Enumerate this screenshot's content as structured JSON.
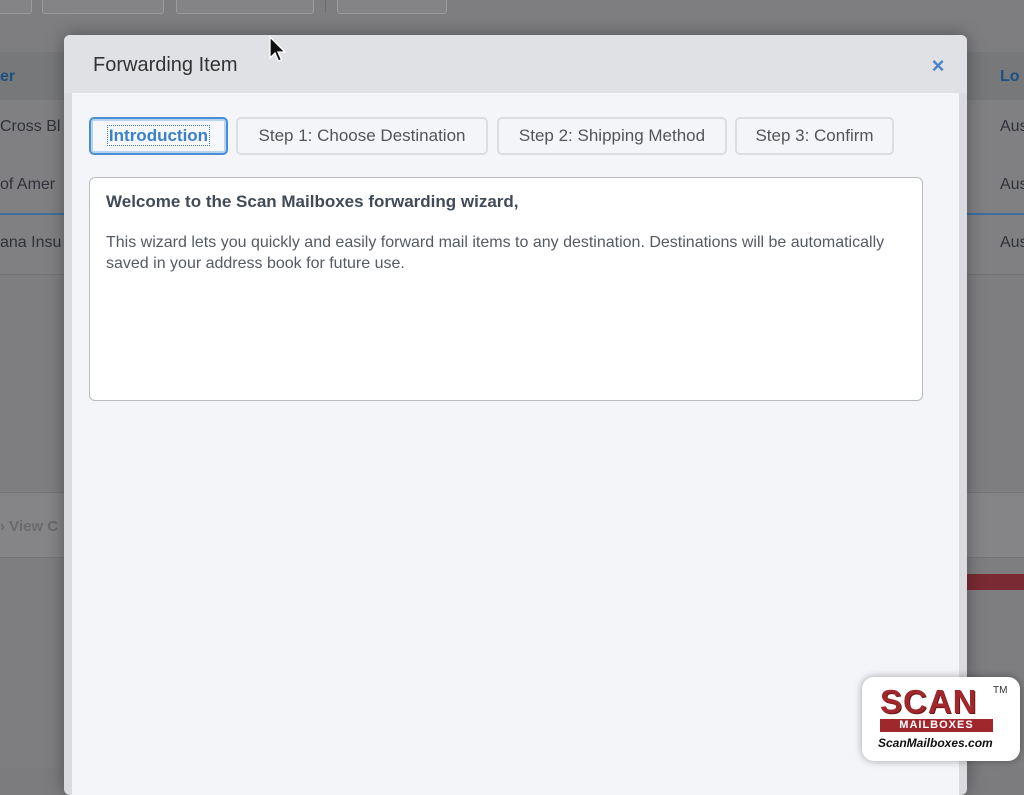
{
  "background": {
    "header_partial_left": "er",
    "header_partial_right": "Lo",
    "rows": [
      {
        "left": "Cross Bl",
        "right": "Aus"
      },
      {
        "left": "of Amer",
        "right": "Aus"
      },
      {
        "left": "ana Insu",
        "right": "Aus"
      }
    ],
    "view_link": "View C"
  },
  "modal": {
    "title": "Forwarding Item",
    "close_icon": "×",
    "tabs": [
      {
        "label": "Introduction",
        "active": true
      },
      {
        "label": "Step 1: Choose Destination",
        "active": false
      },
      {
        "label": "Step 2: Shipping Method",
        "active": false
      },
      {
        "label": "Step 3: Confirm",
        "active": false
      }
    ],
    "content": {
      "welcome": "Welcome to the Scan Mailboxes forwarding wizard,",
      "description": "This wizard lets you quickly and easily forward mail items to any destination. Destinations will be automatically saved in your address book for future use."
    }
  },
  "logo": {
    "scan": "SCAN",
    "mailboxes": "MAILBOXES",
    "tm": "TM",
    "url": "ScanMailboxes.com"
  },
  "colors": {
    "accent": "#4a8fd6",
    "brand_red": "#a0282c"
  }
}
